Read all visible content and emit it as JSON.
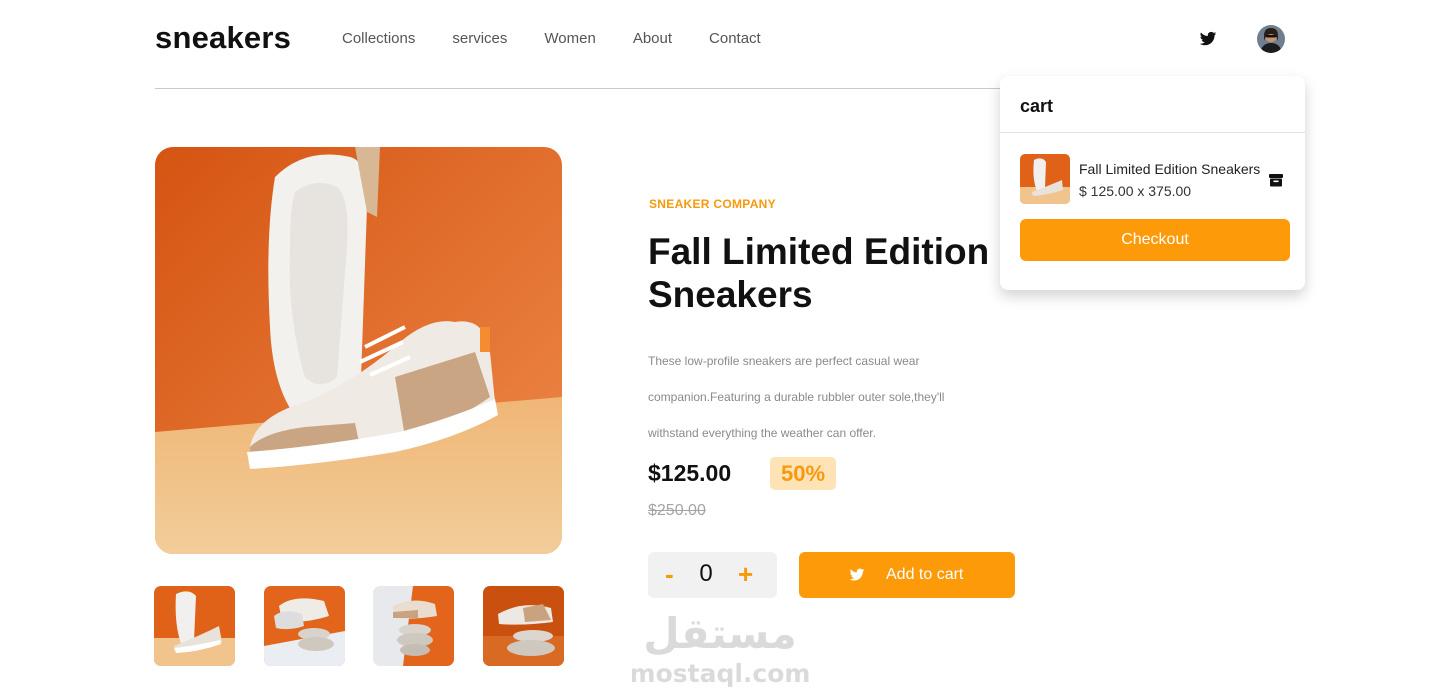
{
  "header": {
    "logo": "sneakers",
    "nav": [
      "Collections",
      "services",
      "Women",
      "About",
      "Contact"
    ],
    "icons": [
      "twitter-icon",
      "avatar"
    ]
  },
  "product": {
    "company": "SNEAKER COMPANY",
    "title": "Fall Limited Edition Sneakers",
    "description": "These low-profile sneakers are perfect casual wear companion.Featuring a durable rubbler outer sole,they'll withstand everything the weather can offer.",
    "price": "$125.00",
    "discount": "50%",
    "old_price": "$250.00",
    "quantity": "0",
    "minus_label": "-",
    "plus_label": "+",
    "add_to_cart_label": "Add to cart",
    "thumbnail_count": 4
  },
  "cart": {
    "title": "cart",
    "item_name": "Fall Limited Edition Sneakers",
    "item_price": "$ 125.00 x 375.00",
    "checkout_label": "Checkout"
  },
  "watermark": {
    "arabic": "مستقل",
    "latin": "mostaql.com"
  },
  "colors": {
    "accent": "#fd9a0a",
    "accent_light": "#fde3b6",
    "photo_orange": "#e5631a",
    "photo_floor": "#f0c48c"
  }
}
